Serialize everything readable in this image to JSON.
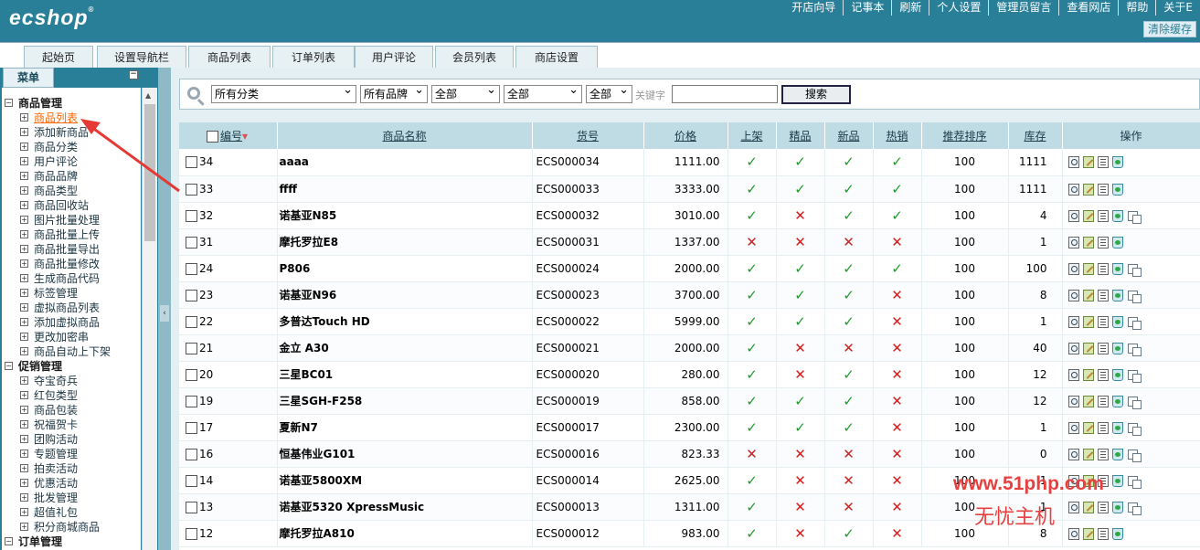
{
  "header": {
    "logo": "ecshop",
    "logo_mark": "®",
    "nav": [
      "开店向导",
      "记事本",
      "刷新",
      "个人设置",
      "管理员留言",
      "查看网店",
      "帮助",
      "关于E"
    ],
    "clear_cache": "清除缓存"
  },
  "tabs": [
    "起始页",
    "设置导航栏",
    "商品列表",
    "订单列表",
    "用户评论",
    "会员列表",
    "商店设置"
  ],
  "sidebar": {
    "title": "菜单",
    "collapse_symbol": "−",
    "groups": [
      {
        "label": "商品管理",
        "expanded": true,
        "items": [
          "商品列表",
          "添加新商品",
          "商品分类",
          "用户评论",
          "商品品牌",
          "商品类型",
          "商品回收站",
          "图片批量处理",
          "商品批量上传",
          "商品批量导出",
          "商品批量修改",
          "生成商品代码",
          "标签管理",
          "虚拟商品列表",
          "添加虚拟商品",
          "更改加密串",
          "商品自动上下架"
        ]
      },
      {
        "label": "促销管理",
        "expanded": true,
        "items": [
          "夺宝奇兵",
          "红包类型",
          "商品包装",
          "祝福贺卡",
          "团购活动",
          "专题管理",
          "拍卖活动",
          "优惠活动",
          "批发管理",
          "超值礼包",
          "积分商城商品"
        ]
      },
      {
        "label": "订单管理",
        "expanded": true,
        "items": []
      }
    ],
    "active_item": "商品列表"
  },
  "search": {
    "category": "所有分类",
    "brand": "所有品牌",
    "filter1": "全部",
    "filter2": "全部",
    "filter3": "全部",
    "keyword_label": "关键字",
    "keyword_value": "",
    "button": "搜索"
  },
  "table": {
    "headers": {
      "id": "编号",
      "name": "商品名称",
      "sn": "货号",
      "price": "价格",
      "on_sale": "上架",
      "best": "精品",
      "new": "新品",
      "hot": "热销",
      "sort": "推荐排序",
      "stock": "库存",
      "ops": "操作"
    },
    "sort_arrow": "▾",
    "yes_mark": "✓",
    "no_mark": "✕",
    "rows": [
      {
        "id": "34",
        "name": "aaaa",
        "sn": "ECS000034",
        "price": "1111.00",
        "flags": [
          true,
          true,
          true,
          true
        ],
        "sort": "100",
        "stock": "1111",
        "dup": false
      },
      {
        "id": "33",
        "name": "ffff",
        "sn": "ECS000033",
        "price": "3333.00",
        "flags": [
          true,
          true,
          true,
          true
        ],
        "sort": "100",
        "stock": "1111",
        "dup": false
      },
      {
        "id": "32",
        "name": "诺基亚N85",
        "sn": "ECS000032",
        "price": "3010.00",
        "flags": [
          true,
          false,
          true,
          true
        ],
        "sort": "100",
        "stock": "4",
        "dup": true
      },
      {
        "id": "31",
        "name": "摩托罗拉E8",
        "sn": "ECS000031",
        "price": "1337.00",
        "flags": [
          false,
          false,
          false,
          false
        ],
        "sort": "100",
        "stock": "1",
        "dup": false
      },
      {
        "id": "24",
        "name": "P806",
        "sn": "ECS000024",
        "price": "2000.00",
        "flags": [
          true,
          true,
          true,
          true
        ],
        "sort": "100",
        "stock": "100",
        "dup": true
      },
      {
        "id": "23",
        "name": "诺基亚N96",
        "sn": "ECS000023",
        "price": "3700.00",
        "flags": [
          true,
          true,
          true,
          false
        ],
        "sort": "100",
        "stock": "8",
        "dup": true
      },
      {
        "id": "22",
        "name": "多普达Touch HD",
        "sn": "ECS000022",
        "price": "5999.00",
        "flags": [
          true,
          true,
          true,
          false
        ],
        "sort": "100",
        "stock": "1",
        "dup": true
      },
      {
        "id": "21",
        "name": "金立 A30",
        "sn": "ECS000021",
        "price": "2000.00",
        "flags": [
          true,
          false,
          false,
          false
        ],
        "sort": "100",
        "stock": "40",
        "dup": true
      },
      {
        "id": "20",
        "name": "三星BC01",
        "sn": "ECS000020",
        "price": "280.00",
        "flags": [
          true,
          false,
          true,
          false
        ],
        "sort": "100",
        "stock": "12",
        "dup": true
      },
      {
        "id": "19",
        "name": "三星SGH-F258",
        "sn": "ECS000019",
        "price": "858.00",
        "flags": [
          true,
          true,
          true,
          false
        ],
        "sort": "100",
        "stock": "12",
        "dup": true
      },
      {
        "id": "17",
        "name": "夏新N7",
        "sn": "ECS000017",
        "price": "2300.00",
        "flags": [
          true,
          true,
          true,
          false
        ],
        "sort": "100",
        "stock": "1",
        "dup": true
      },
      {
        "id": "16",
        "name": "恒基伟业G101",
        "sn": "ECS000016",
        "price": "823.33",
        "flags": [
          false,
          false,
          false,
          false
        ],
        "sort": "100",
        "stock": "0",
        "dup": true
      },
      {
        "id": "14",
        "name": "诺基亚5800XM",
        "sn": "ECS000014",
        "price": "2625.00",
        "flags": [
          true,
          false,
          false,
          false
        ],
        "sort": "100",
        "stock": "1",
        "dup": true
      },
      {
        "id": "13",
        "name": "诺基亚5320 XpressMusic",
        "sn": "ECS000013",
        "price": "1311.00",
        "flags": [
          true,
          false,
          false,
          false
        ],
        "sort": "100",
        "stock": "1",
        "dup": true
      },
      {
        "id": "12",
        "name": "摩托罗拉A810",
        "sn": "ECS000012",
        "price": "983.00",
        "flags": [
          true,
          false,
          true,
          false
        ],
        "sort": "100",
        "stock": "8",
        "dup": false
      }
    ]
  },
  "watermark": {
    "line1": "www.51php.com",
    "line2": "无忧主机"
  },
  "colors": {
    "header_bg": "#2a7f98",
    "table_header_bg": "#bfdce4",
    "yes": "#1f9b2c",
    "no": "#d01f1f",
    "active_link": "#ff6600",
    "watermark": "#e74040",
    "annotation_arrow": "#e53935"
  }
}
